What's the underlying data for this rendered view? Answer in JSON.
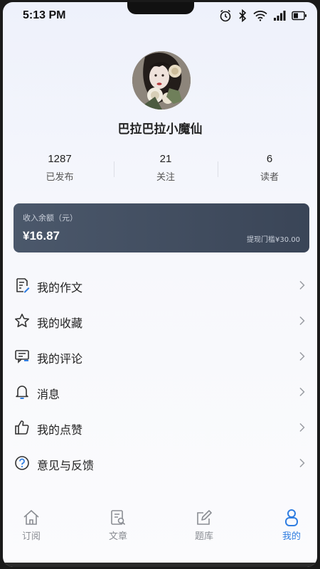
{
  "status_bar": {
    "time": "5:13 PM"
  },
  "profile": {
    "username": "巴拉巴拉小魔仙"
  },
  "stats": [
    {
      "value": "1287",
      "label": "已发布"
    },
    {
      "value": "21",
      "label": "关注"
    },
    {
      "value": "6",
      "label": "读者"
    }
  ],
  "balance": {
    "label": "收入余额（元）",
    "amount": "¥16.87",
    "threshold": "提现门槛¥30.00"
  },
  "menu": [
    {
      "label": "我的作文",
      "icon": "compose-icon"
    },
    {
      "label": "我的收藏",
      "icon": "star-icon"
    },
    {
      "label": "我的评论",
      "icon": "comment-icon"
    },
    {
      "label": "消息",
      "icon": "bell-icon"
    },
    {
      "label": "我的点赞",
      "icon": "thumbs-up-icon"
    },
    {
      "label": "意见与反馈",
      "icon": "question-icon"
    }
  ],
  "tabs": [
    {
      "label": "订阅",
      "icon": "home-icon",
      "active": false
    },
    {
      "label": "文章",
      "icon": "article-icon",
      "active": false
    },
    {
      "label": "题库",
      "icon": "edit-icon",
      "active": false
    },
    {
      "label": "我的",
      "icon": "user-icon",
      "active": true
    }
  ],
  "colors": {
    "accent": "#2f7de1",
    "card": "#44505f"
  }
}
